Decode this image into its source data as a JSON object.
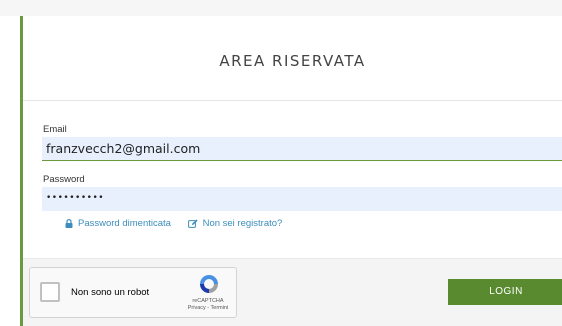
{
  "header": {
    "title": "AREA RISERVATA"
  },
  "form": {
    "email": {
      "label": "Email",
      "value": "franzvecch2@gmail.com"
    },
    "password": {
      "label": "Password",
      "value": "••••••••••"
    }
  },
  "links": {
    "forgot_password": "Password dimenticata",
    "not_registered": "Non sei registrato?"
  },
  "recaptcha": {
    "label": "Non sono un robot",
    "brand": "reCAPTCHA",
    "terms": "Privacy - Termini"
  },
  "login_button": {
    "label": "LOGIN"
  },
  "colors": {
    "accent": "#5a8a2f",
    "link": "#3c8dbc",
    "field_bg": "#e8f0fe"
  },
  "icons": {
    "forgot": "lock-icon",
    "register": "edit-icon",
    "captcha": "recaptcha-logo-icon"
  }
}
